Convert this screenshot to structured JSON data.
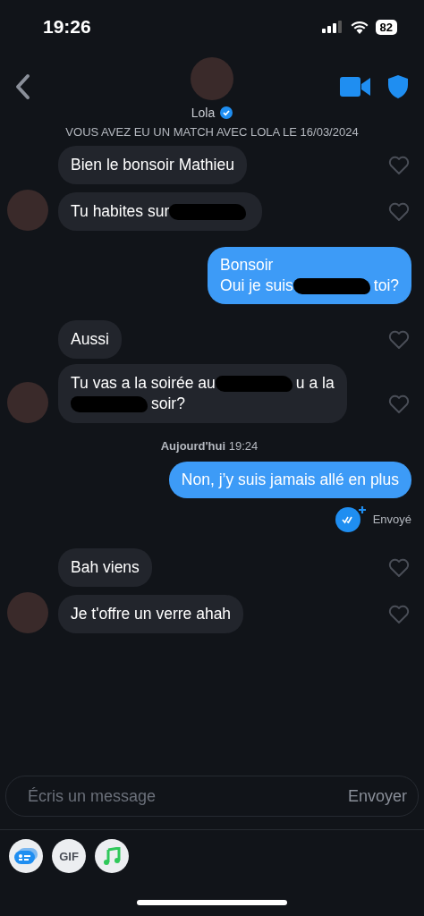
{
  "status_bar": {
    "time": "19:26",
    "battery": "82"
  },
  "header": {
    "name": "Lola",
    "verified": true
  },
  "match_notice": "VOUS AVEZ EU UN MATCH AVEC LOLA LE 16/03/2024",
  "items": [
    {
      "kind": "message",
      "outgoing": false,
      "avatar": false,
      "liked": false,
      "parts": [
        {
          "kind": "text",
          "text": "Bien le bonsoir Mathieu"
        }
      ]
    },
    {
      "kind": "message",
      "outgoing": false,
      "avatar": true,
      "liked": false,
      "parts": [
        {
          "kind": "text",
          "text": "Tu habites sur"
        },
        {
          "kind": "redacted"
        }
      ]
    },
    {
      "kind": "message",
      "outgoing": true,
      "parts": [
        {
          "kind": "text",
          "text": "Bonsoir"
        },
        {
          "kind": "break"
        },
        {
          "kind": "text",
          "text": "Oui je suis"
        },
        {
          "kind": "redacted"
        },
        {
          "kind": "text",
          "text": "toi?"
        }
      ]
    },
    {
      "kind": "message",
      "outgoing": false,
      "avatar": false,
      "liked": false,
      "parts": [
        {
          "kind": "text",
          "text": "Aussi"
        }
      ]
    },
    {
      "kind": "message",
      "outgoing": false,
      "avatar": true,
      "liked": false,
      "parts": [
        {
          "kind": "text",
          "text": "Tu vas a la soirée au"
        },
        {
          "kind": "redacted"
        },
        {
          "kind": "text",
          "text": "u a la"
        },
        {
          "kind": "break"
        },
        {
          "kind": "redacted"
        },
        {
          "kind": "text",
          "text": "soir?"
        }
      ]
    },
    {
      "kind": "date",
      "bold": "Aujourd'hui",
      "time": "19:24"
    },
    {
      "kind": "message",
      "outgoing": true,
      "status": "Envoyé",
      "parts": [
        {
          "kind": "text",
          "text": "Non, j’y suis jamais allé en plus"
        }
      ]
    },
    {
      "kind": "message",
      "outgoing": false,
      "avatar": false,
      "liked": false,
      "parts": [
        {
          "kind": "text",
          "text": "Bah viens"
        }
      ]
    },
    {
      "kind": "message",
      "outgoing": false,
      "avatar": true,
      "liked": false,
      "parts": [
        {
          "kind": "text",
          "text": "Je t'offre un verre ahah"
        }
      ]
    }
  ],
  "composer": {
    "placeholder": "Écris un message",
    "send": "Envoyer"
  },
  "attachments": [
    {
      "kind": "card"
    },
    {
      "kind": "gif",
      "label": "GIF"
    },
    {
      "kind": "music"
    }
  ]
}
